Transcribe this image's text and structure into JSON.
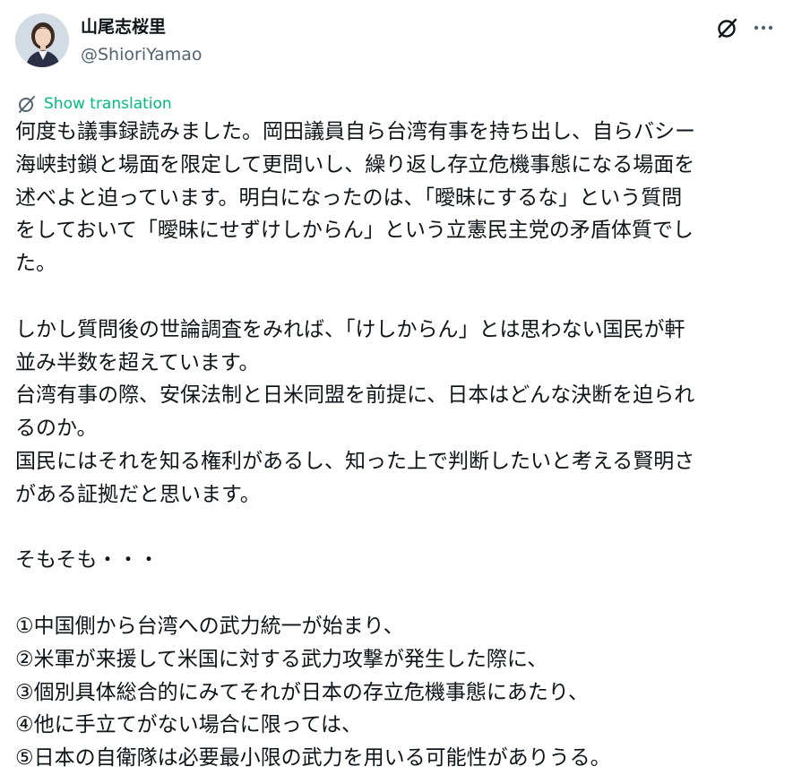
{
  "author": {
    "display_name": "山尾志桜里",
    "handle": "@ShioriYamao",
    "avatar_icon": "profile-photo"
  },
  "header_icons": {
    "grok": "grok-icon",
    "more": "more-icon"
  },
  "translation": {
    "label": "Show translation",
    "color": "#00ba7c"
  },
  "colors": {
    "text": "#0f1419",
    "secondary": "#536471"
  },
  "post": {
    "lines": [
      "何度も議事録読みました。岡田議員自ら台湾有事を持ち出し、自らバシー",
      "海峡封鎖と場面を限定して更問いし、繰り返し存立危機事態になる場面を",
      "述べよと迫っています。明白になったのは、「曖昧にするな」という質問",
      "をしておいて「曖昧にせずけしからん」という立憲民主党の矛盾体質でし",
      "た。",
      "",
      "しかし質問後の世論調査をみれば、「けしからん」とは思わない国民が軒",
      "並み半数を超えています。",
      "台湾有事の際、安保法制と日米同盟を前提に、日本はどんな決断を迫られ",
      "るのか。",
      "国民にはそれを知る権利があるし、知った上で判断したいと考える賢明さ",
      "がある証拠だと思います。",
      "",
      "そもそも・・・",
      "",
      "①中国側から台湾への武力統一が始まり、",
      "②米軍が来援して米国に対する武力攻撃が発生した際に、",
      "③個別具体総合的にみてそれが日本の存立危機事態にあたり、",
      "④他に手立てがない場合に限っては、",
      "⑤日本の自衛隊は必要最小限の武力を用いる可能性がありうる。"
    ]
  }
}
